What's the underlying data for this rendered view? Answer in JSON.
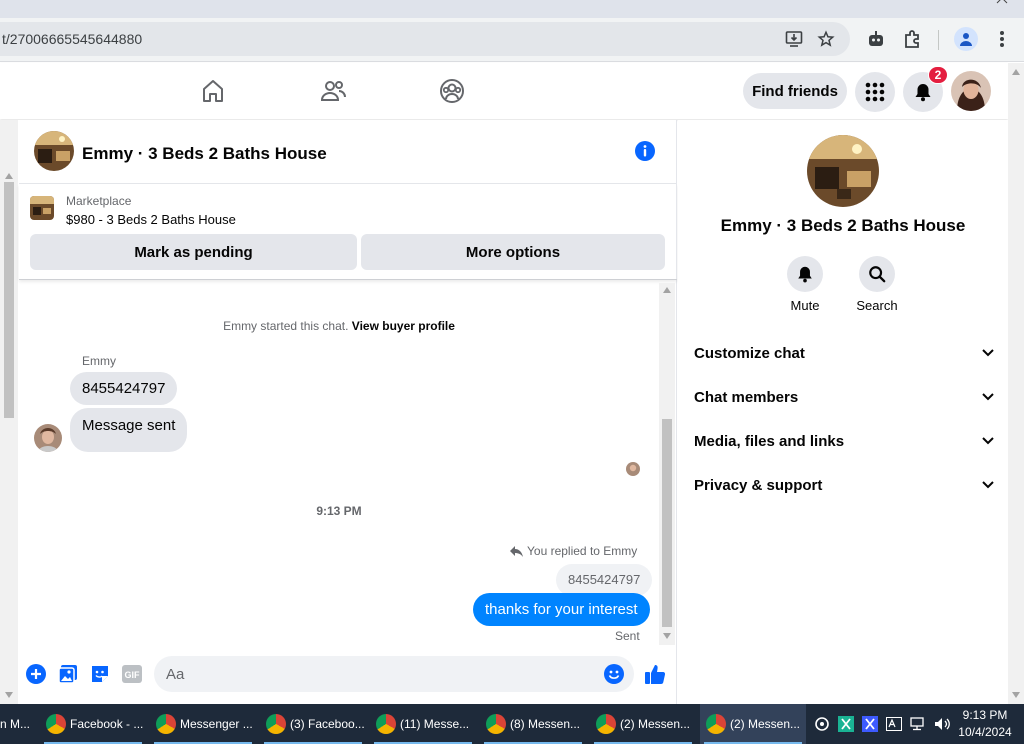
{
  "browser": {
    "url": "t/27006665545644880"
  },
  "header": {
    "find_friends_label": "Find friends",
    "notification_count": "2"
  },
  "chat": {
    "title": "Emmy · 3 Beds 2 Baths House",
    "marketplace_label": "Marketplace",
    "listing": "$980 - 3 Beds 2 Baths House",
    "mark_pending_label": "Mark as pending",
    "more_options_label": "More options",
    "started_text": "Emmy started this chat.",
    "view_buyer_label": "View buyer profile",
    "sender_name": "Emmy",
    "incoming": [
      "8455424797",
      "Message sent"
    ],
    "timestamp": "9:13 PM",
    "replied_label": "You replied to Emmy",
    "quoted": "8455424797",
    "outgoing": "thanks for your interest",
    "sent_status": "Sent",
    "composer_placeholder": "Aa"
  },
  "details": {
    "name": "Emmy · 3 Beds 2 Baths House",
    "mute_label": "Mute",
    "search_label": "Search",
    "rows": [
      "Customize chat",
      "Chat members",
      "Media, files and links",
      "Privacy & support"
    ]
  },
  "taskbar": {
    "items": [
      "n M...",
      "Facebook - ...",
      "Messenger ...",
      "(3) Faceboo...",
      "(11) Messe...",
      "(8) Messen...",
      "(2) Messen...",
      "(2) Messen..."
    ],
    "time": "9:13 PM",
    "date": "10/4/2024"
  },
  "colors": {
    "accent": "#0084ff",
    "fb_blue": "#1877f2",
    "badge": "#e41e3f"
  }
}
